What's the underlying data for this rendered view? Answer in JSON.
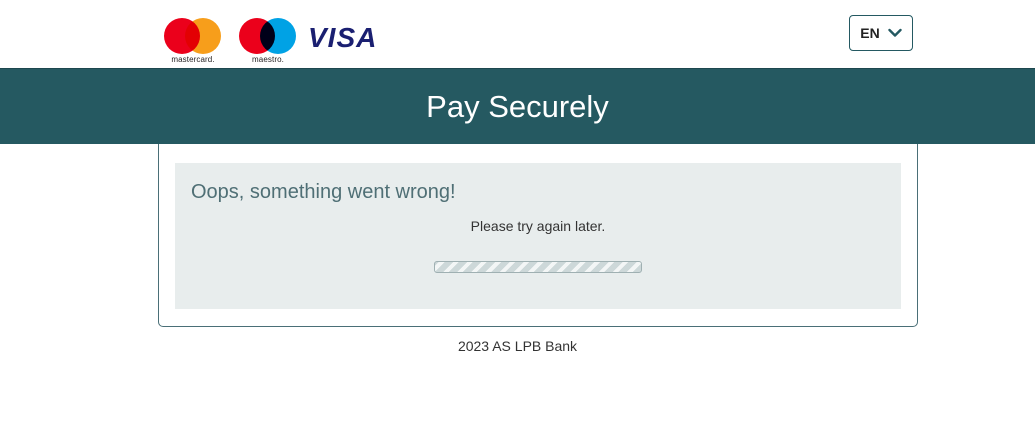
{
  "header": {
    "card_logos": [
      {
        "name": "mastercard",
        "caption": "mastercard.",
        "colors": [
          "#eb001b",
          "#f79e1b"
        ]
      },
      {
        "name": "maestro",
        "caption": "maestro.",
        "colors": [
          "#eb001b",
          "#00a2e5"
        ]
      },
      {
        "name": "visa",
        "text": "VISA",
        "color": "#1a1f71"
      }
    ],
    "language_selector": {
      "value": "EN",
      "icon": "chevron-down-icon"
    }
  },
  "banner": {
    "title": "Pay Securely",
    "background": "#255961"
  },
  "error": {
    "title": "Oops, something went wrong!",
    "message": "Please try again later.",
    "progress_indicator": "indeterminate-striped"
  },
  "footer": {
    "text": "2023 AS LPB Bank"
  }
}
